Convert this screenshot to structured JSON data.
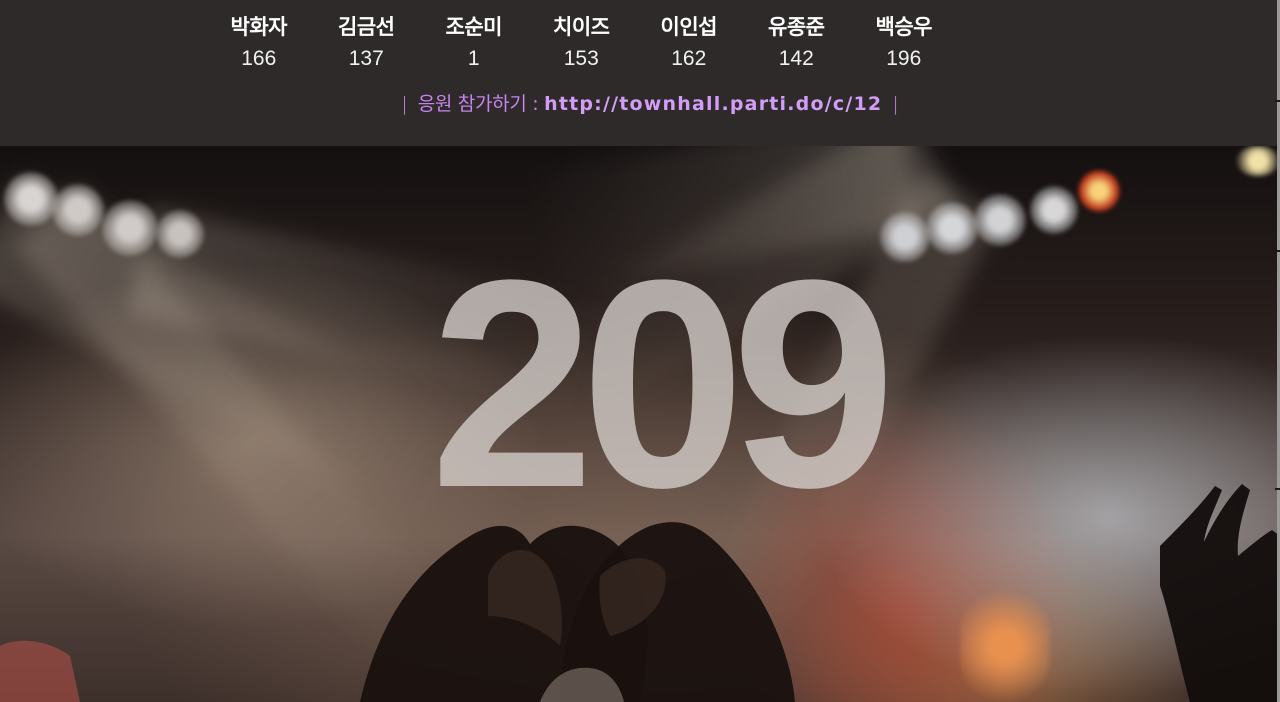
{
  "scoreboard": [
    {
      "name": "박화자",
      "count": "166"
    },
    {
      "name": "김금선",
      "count": "137"
    },
    {
      "name": "조순미",
      "count": "1"
    },
    {
      "name": "치이즈",
      "count": "153"
    },
    {
      "name": "이인섭",
      "count": "162"
    },
    {
      "name": "유종준",
      "count": "142"
    },
    {
      "name": "백승우",
      "count": "196"
    }
  ],
  "cta": {
    "pipe_left": "|",
    "label": "응원 참가하기 : ",
    "url": "http://townhall.parti.do/c/12",
    "pipe_right": "|"
  },
  "hero": {
    "total": "209"
  },
  "colors": {
    "topbar_bg": "#2d2a29",
    "accent": "#c784ef"
  }
}
